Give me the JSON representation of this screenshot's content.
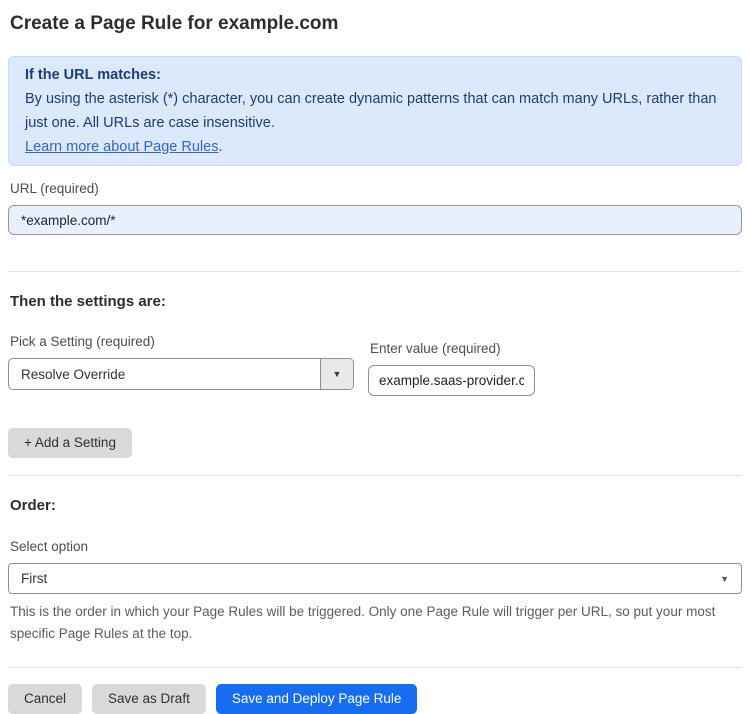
{
  "page": {
    "title": "Create a Page Rule for example.com"
  },
  "info_box": {
    "heading": "If the URL matches:",
    "body": "By using the asterisk (*) character, you can create dynamic patterns that can match many URLs, rather than just one. All URLs are case insensitive.",
    "link_text": "Learn more about Page Rules",
    "link_suffix": "."
  },
  "url_field": {
    "label": "URL (required)",
    "value": "*example.com/*"
  },
  "settings_section": {
    "heading": "Then the settings are:",
    "setting_label": "Pick a Setting (required)",
    "setting_value": "Resolve Override",
    "value_label": "Enter value (required)",
    "value_value": "example.saas-provider.c",
    "add_button_label": "+ Add a Setting"
  },
  "order_section": {
    "heading": "Order:",
    "select_label": "Select option",
    "select_value": "First",
    "help_text": "This is the order in which your Page Rules will be triggered. Only one Page Rule will trigger per URL, so put your most specific Page Rules at the top."
  },
  "footer": {
    "cancel_label": "Cancel",
    "save_draft_label": "Save as Draft",
    "save_deploy_label": "Save and Deploy Page Rule"
  },
  "icons": {
    "dropdown_arrow": "▼"
  },
  "colors": {
    "accent_blue": "#176df2",
    "info_box_bg": "#dbe9fb",
    "info_box_border": "#c5daf6",
    "info_box_text": "#1d3c78",
    "link_blue": "#3268c7",
    "autofill_input_bg": "#e8f0fe",
    "gray_button_bg": "#d9d9d9"
  }
}
